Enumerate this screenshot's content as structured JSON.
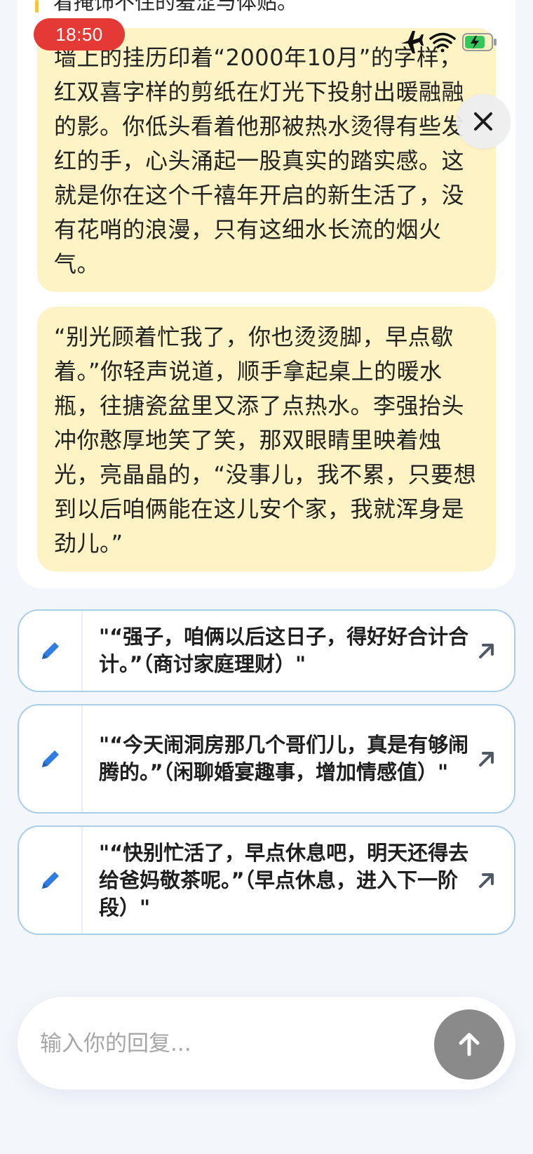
{
  "status_bar": {
    "time": "18:50"
  },
  "story": {
    "top_fragment": "看掩饰不住的羞涩与体贴。",
    "block_1": "墙上的挂历印着“2000年10月”的字样，红双喜字样的剪纸在灯光下投射出暖融融的影。你低头看着他那被热水烫得有些发红的手，心头涌起一股真实的踏实感。这就是你在这个千禧年开启的新生活了，没有花哨的浪漫，只有这细水长流的烟火气。",
    "block_2": "“别光顾着忙我了，你也烫烫脚，早点歇着。”你轻声说道，顺手拿起桌上的暖水瓶，往搪瓷盆里又添了点热水。李强抬头冲你憨厚地笑了笑，那双眼睛里映着烛光，亮晶晶的，“没事儿，我不累，只要想到以后咱俩能在这儿安个家，我就浑身是劲儿。”"
  },
  "options": [
    {
      "text": "\"“强子，咱俩以后这日子，得好好合计合计。”（商讨家庭理财）\""
    },
    {
      "text": "\"“今天闹洞房那几个哥们儿，真是有够闹腾的。”（闲聊婚宴趣事，增加情感值）\""
    },
    {
      "text": "\"“快别忙活了，早点休息吧，明天还得去给爸妈敬茶呢。”（早点休息，进入下一阶段）\""
    }
  ],
  "composer": {
    "placeholder": "输入你的回复...",
    "value": ""
  },
  "icons": {
    "edit": "pencil-icon",
    "open": "arrow-up-right-icon",
    "send": "arrow-up-icon",
    "close": "close-icon"
  },
  "colors": {
    "story_bg": "#fdf3c4",
    "option_border": "#a9cfe9",
    "pencil_blue": "#2f7de0",
    "time_pill": "#e53935",
    "send_button": "#8a8a8a"
  }
}
